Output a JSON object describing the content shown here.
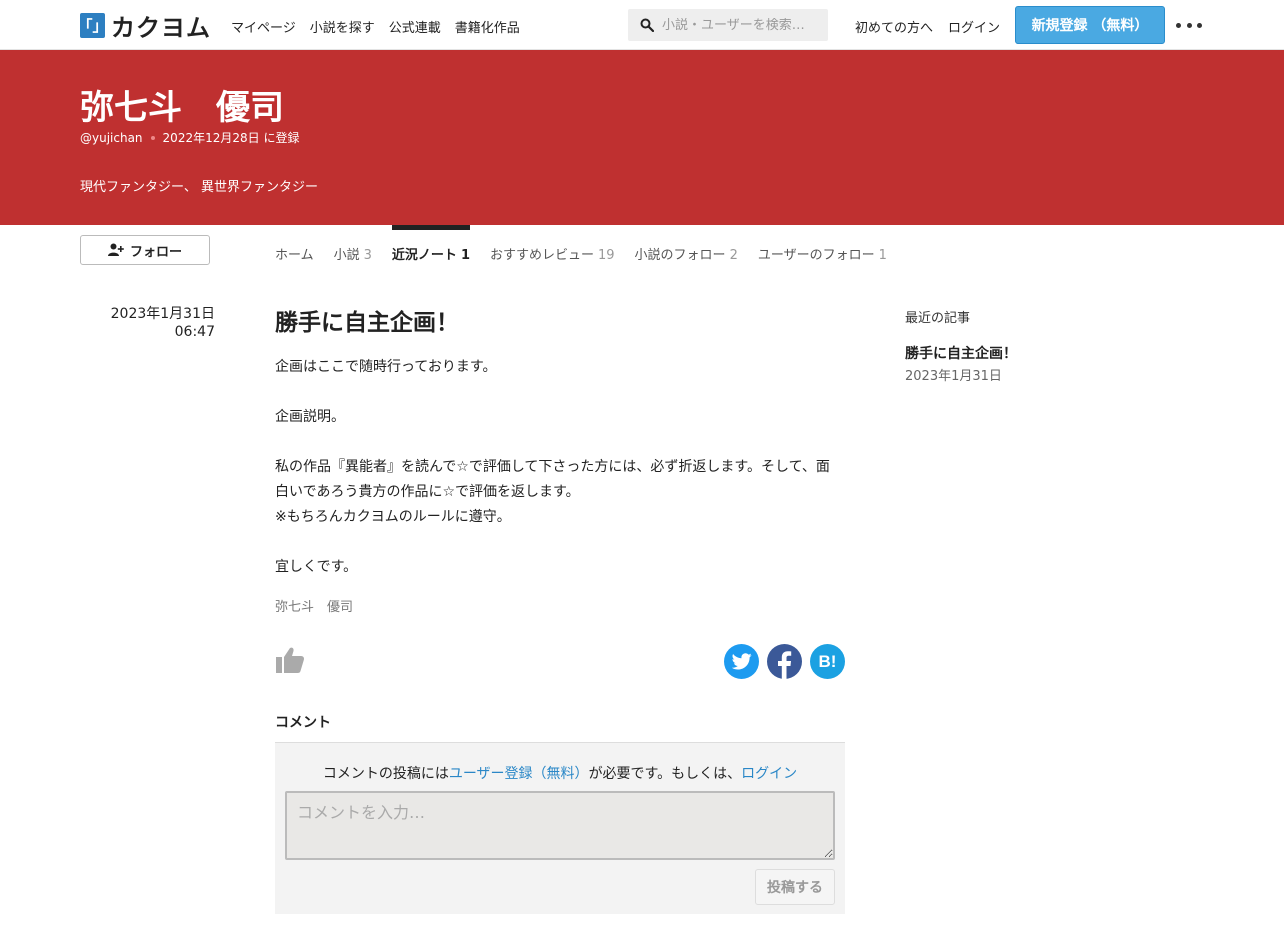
{
  "header": {
    "logo_mark": "「」",
    "logo_text": "カクヨム",
    "nav": [
      "マイページ",
      "小説を探す",
      "公式連載",
      "書籍化作品"
    ],
    "search_placeholder": "小説・ユーザーを検索…",
    "beginner_link": "初めての方へ",
    "login_link": "ログイン",
    "signup_button": "新規登録 （無料）"
  },
  "author": {
    "name": "弥七斗　優司",
    "handle": "@yujichan",
    "registered": "2022年12月28日 に登録",
    "genres": "現代ファンタジー、 異世界ファンタジー"
  },
  "follow_button": "フォロー",
  "tabs": [
    {
      "label": "ホーム",
      "count": ""
    },
    {
      "label": "小説",
      "count": "3"
    },
    {
      "label": "近況ノート",
      "count": "1"
    },
    {
      "label": "おすすめレビュー",
      "count": "19"
    },
    {
      "label": "小説のフォロー",
      "count": "2"
    },
    {
      "label": "ユーザーのフォロー",
      "count": "1"
    }
  ],
  "post": {
    "date": "2023年1月31日",
    "time": "06:47",
    "title": "勝手に自主企画！",
    "lines": [
      "企画はここで随時行っております。",
      "",
      "企画説明。",
      "",
      "私の作品『異能者』を読んで☆で評価して下さった方には、必ず折返します。そして、面",
      "白いであろう貴方の作品に☆で評価を返します。",
      "※もちろんカクヨムのルールに遵守。",
      "",
      "宜しくです。"
    ],
    "signature": "弥七斗　優司"
  },
  "share": {
    "hatena_label": "B!"
  },
  "comments": {
    "heading": "コメント",
    "note_prefix": "コメントの投稿には",
    "note_signup_link": "ユーザー登録（無料）",
    "note_middle": "が必要です。もしくは、",
    "note_login_link": "ログイン",
    "input_placeholder": "コメントを入力…",
    "post_button": "投稿する"
  },
  "sidebar": {
    "heading": "最近の記事",
    "recent": [
      {
        "title": "勝手に自主企画！",
        "date": "2023年1月31日"
      }
    ]
  },
  "colors": {
    "banner": "#bf3030",
    "signup": "#4aa9e2",
    "link": "#2a87c7",
    "twitter": "#1d9bf0",
    "facebook": "#3b5998",
    "hatena": "#1ba1e2"
  }
}
